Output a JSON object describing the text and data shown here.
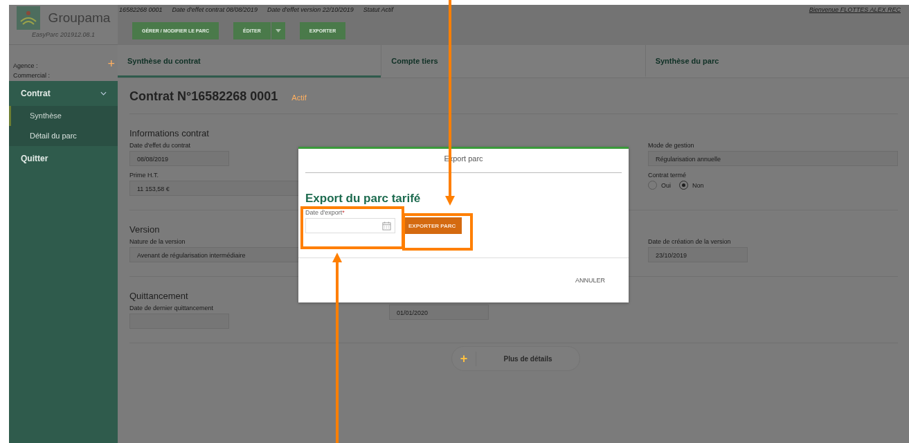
{
  "brand": {
    "name": "Groupama",
    "version": "EasyParc 201912.08.1"
  },
  "sidebar": {
    "agency_label": "Agence :",
    "sales_label": "Commercial :",
    "menu": [
      {
        "label": "Contrat",
        "expanded": true,
        "children": [
          {
            "label": "Synthèse",
            "selected": true
          },
          {
            "label": "Détail du parc",
            "selected": false
          }
        ]
      },
      {
        "label": "Quitter",
        "expanded": false
      }
    ]
  },
  "info_bar": {
    "items": [
      "16582268 0001",
      "Date d'effet contrat 08/08/2019",
      "Date d'effet version 22/10/2019",
      "Statut Actif"
    ],
    "welcome": "Bienvenue FLOTTES ALEX REC"
  },
  "toolbar": [
    {
      "label": "GÉRER / MODIFIER LE PARC",
      "kind": "plain"
    },
    {
      "label": "ÉDITER",
      "kind": "dropdown"
    },
    {
      "label": "EXPORTER",
      "kind": "plain"
    }
  ],
  "tabs": [
    {
      "label": "Synthèse du contrat",
      "selected": true
    },
    {
      "label": "Compte tiers",
      "selected": false
    },
    {
      "label": "Synthèse du parc",
      "selected": false
    }
  ],
  "contract": {
    "title": "Contrat N°16582268 0001",
    "status": "Actif"
  },
  "sections": [
    {
      "title": "Informations contrat",
      "rows": [
        [
          {
            "kind": "text",
            "label": "Date d'effet du contrat",
            "value": "08/08/2019"
          },
          null,
          {
            "kind": "text",
            "label": "Mode de gestion",
            "value": "Régularisation annuelle"
          }
        ],
        [
          {
            "kind": "text",
            "label": "Prime H.T.",
            "value": "11 153,58 €"
          },
          null,
          {
            "kind": "radio",
            "label": "Contrat termé",
            "options": [
              {
                "label": "Oui",
                "selected": false
              },
              {
                "label": "Non",
                "selected": true
              }
            ]
          }
        ]
      ]
    },
    {
      "title": "Version",
      "rows": [
        [
          {
            "kind": "text",
            "label": "Nature de la version",
            "value": "Avenant de régularisation intermédiaire"
          },
          null,
          {
            "kind": "text",
            "label": "Date de création de la version",
            "value": "23/10/2019"
          }
        ]
      ]
    },
    {
      "title": "Quittancement",
      "rows": [
        [
          {
            "kind": "text",
            "label": "Date de dernier quittancement"
          },
          {
            "kind": "text",
            "value": "01/01/2020"
          },
          null
        ]
      ]
    }
  ],
  "add_sign": "+",
  "more_button": {
    "icon": "+",
    "label": "Plus de détails"
  },
  "dialog": {
    "title": "Export parc",
    "heading": "Export du parc tarifé",
    "field": {
      "label": "Date d'export",
      "required_mark": "*"
    },
    "action": "EXPORTER PARC",
    "cancel": "ANNULER"
  }
}
